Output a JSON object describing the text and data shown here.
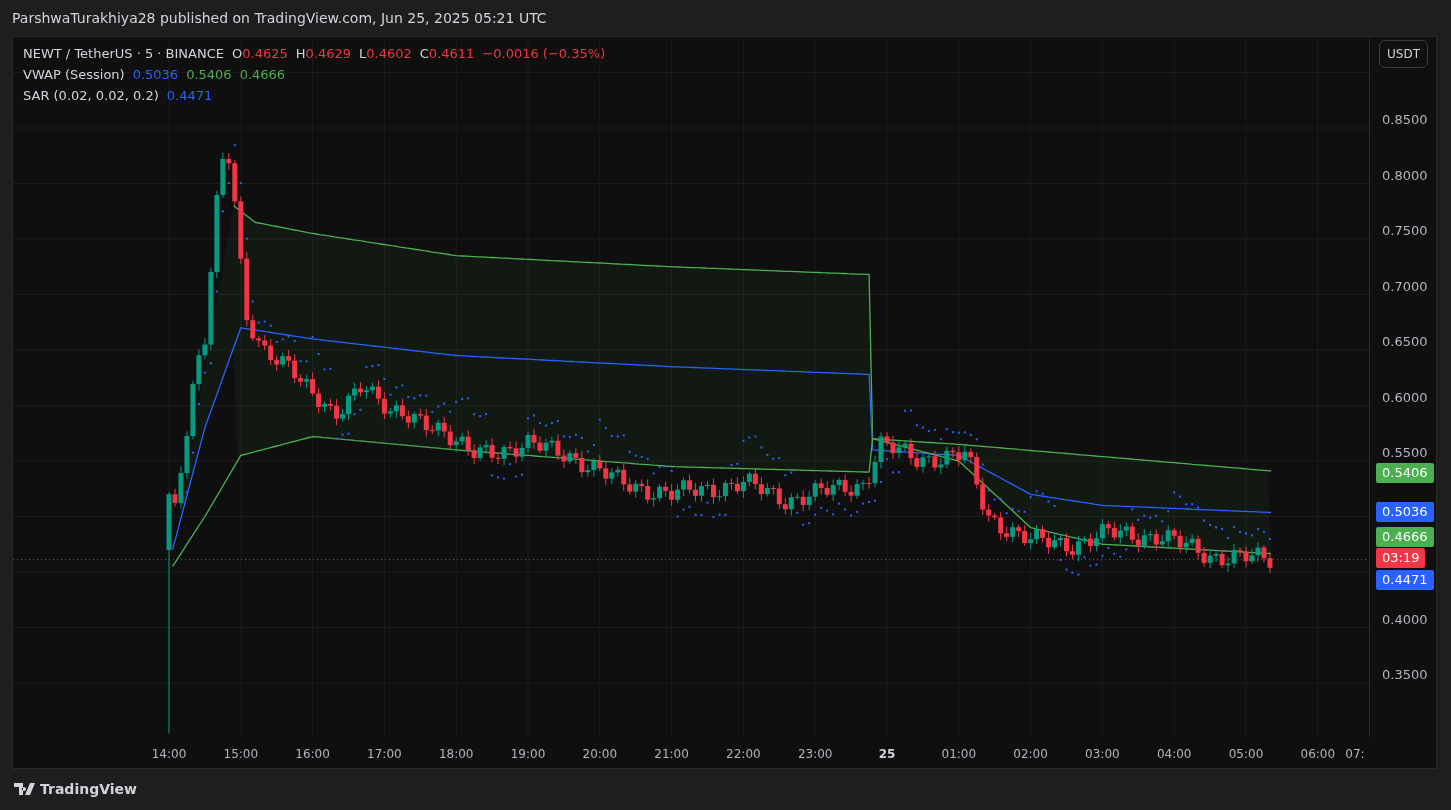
{
  "header": {
    "text": "ParshwaTurakhiya28 published on TradingView.com, Jun 25, 2025 05:21 UTC"
  },
  "legend": {
    "symbol": "NEWT / TetherUS · 5 · BINANCE",
    "ohlc": [
      {
        "label": "O",
        "value": "0.4625",
        "color": "#f23645"
      },
      {
        "label": "H",
        "value": "0.4629",
        "color": "#f23645"
      },
      {
        "label": "L",
        "value": "0.4602",
        "color": "#f23645"
      },
      {
        "label": "C",
        "value": "0.4611",
        "color": "#f23645"
      }
    ],
    "change": {
      "text": "−0.0016 (−0.35%)",
      "color": "#f23645"
    },
    "indicators": [
      {
        "name": "VWAP (Session)",
        "values": [
          {
            "text": "0.5036",
            "color": "#2962ff"
          },
          {
            "text": "0.5406",
            "color": "#4caf50"
          },
          {
            "text": "0.4666",
            "color": "#4caf50"
          }
        ]
      },
      {
        "name": "SAR (0.02, 0.02, 0.2)",
        "values": [
          {
            "text": "0.4471",
            "color": "#2962ff"
          }
        ]
      }
    ]
  },
  "currency_button": "USDT",
  "price_axis": {
    "ticks": [
      "0.8500",
      "0.8000",
      "0.7500",
      "0.7000",
      "0.6500",
      "0.6000",
      "0.5500",
      "0.4000",
      "0.3500"
    ]
  },
  "price_tags": [
    {
      "text": "0.5406",
      "color": "#4caf50"
    },
    {
      "text": "0.5036",
      "color": "#2962ff"
    },
    {
      "text": "0.4666",
      "color": "#4caf50"
    },
    {
      "text": "03:19",
      "color": "#f23645"
    },
    {
      "text": "0.4471",
      "color": "#2962ff"
    }
  ],
  "time_axis": [
    {
      "text": "14:00",
      "bold": false
    },
    {
      "text": "15:00",
      "bold": false
    },
    {
      "text": "16:00",
      "bold": false
    },
    {
      "text": "17:00",
      "bold": false
    },
    {
      "text": "18:00",
      "bold": false
    },
    {
      "text": "19:00",
      "bold": false
    },
    {
      "text": "20:00",
      "bold": false
    },
    {
      "text": "21:00",
      "bold": false
    },
    {
      "text": "22:00",
      "bold": false
    },
    {
      "text": "23:00",
      "bold": false
    },
    {
      "text": "25",
      "bold": true
    },
    {
      "text": "01:00",
      "bold": false
    },
    {
      "text": "02:00",
      "bold": false
    },
    {
      "text": "03:00",
      "bold": false
    },
    {
      "text": "04:00",
      "bold": false
    },
    {
      "text": "05:00",
      "bold": false
    },
    {
      "text": "06:00",
      "bold": false
    },
    {
      "text": "07:",
      "bold": false
    }
  ],
  "footer": {
    "brand": "TradingView"
  }
}
